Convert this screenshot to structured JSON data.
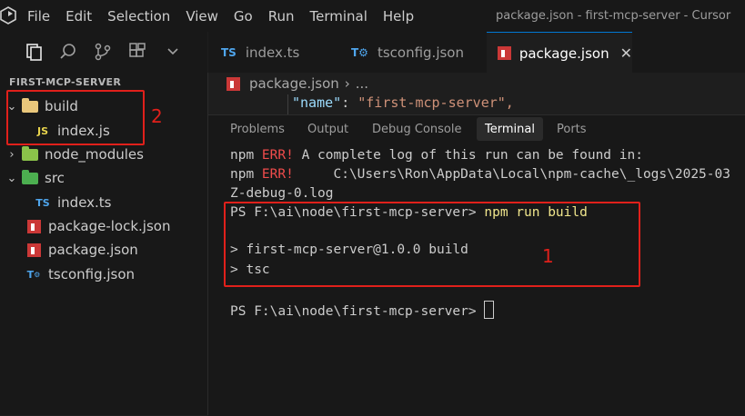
{
  "menu": [
    "File",
    "Edit",
    "Selection",
    "View",
    "Go",
    "Run",
    "Terminal",
    "Help"
  ],
  "window_title": "package.json - first-mcp-server - Cursor",
  "explorer": {
    "title": "FIRST-MCP-SERVER",
    "items": [
      {
        "label": "build",
        "type": "folder",
        "expanded": true
      },
      {
        "label": "index.js",
        "type": "js"
      },
      {
        "label": "node_modules",
        "type": "folder"
      },
      {
        "label": "src",
        "type": "folder"
      },
      {
        "label": "index.ts",
        "type": "ts"
      },
      {
        "label": "package-lock.json",
        "type": "npm"
      },
      {
        "label": "package.json",
        "type": "npm"
      },
      {
        "label": "tsconfig.json",
        "type": "tsconfig"
      }
    ]
  },
  "tabs": [
    {
      "label": "index.ts",
      "icon": "TS"
    },
    {
      "label": "tsconfig.json",
      "icon": "TS"
    },
    {
      "label": "package.json",
      "icon": "npm",
      "active": true
    }
  ],
  "breadcrumb": {
    "file": "package.json",
    "sep": "›",
    "rest": "..."
  },
  "code": {
    "key": "\"name\"",
    "colon": ": ",
    "value": "\"first-mcp-server\","
  },
  "panel_tabs": [
    "Problems",
    "Output",
    "Debug Console",
    "Terminal",
    "Ports"
  ],
  "terminal": {
    "line1_prefix": "npm ",
    "line1_err": "ERR!",
    "line1_rest": " A complete log of this run can be found in:",
    "line2_prefix": "npm ",
    "line2_err": "ERR!",
    "line2_rest": "     C:\\Users\\Ron\\AppData\\Local\\npm-cache\\_logs\\2025-03",
    "line3": "Z-debug-0.log",
    "prompt1": "PS F:\\ai\\node\\first-mcp-server> ",
    "cmd": "npm run build",
    "out1": "> first-mcp-server@1.0.0 build",
    "out2": "> tsc",
    "prompt2": "PS F:\\ai\\node\\first-mcp-server> "
  },
  "annotations": {
    "one": "1",
    "two": "2"
  },
  "colors": {
    "accent": "#0078d4",
    "annotation_red": "#e0201b",
    "npm_red": "#cb3837",
    "ts_blue": "#4fa6ed",
    "js_yellow": "#e8d44d"
  }
}
